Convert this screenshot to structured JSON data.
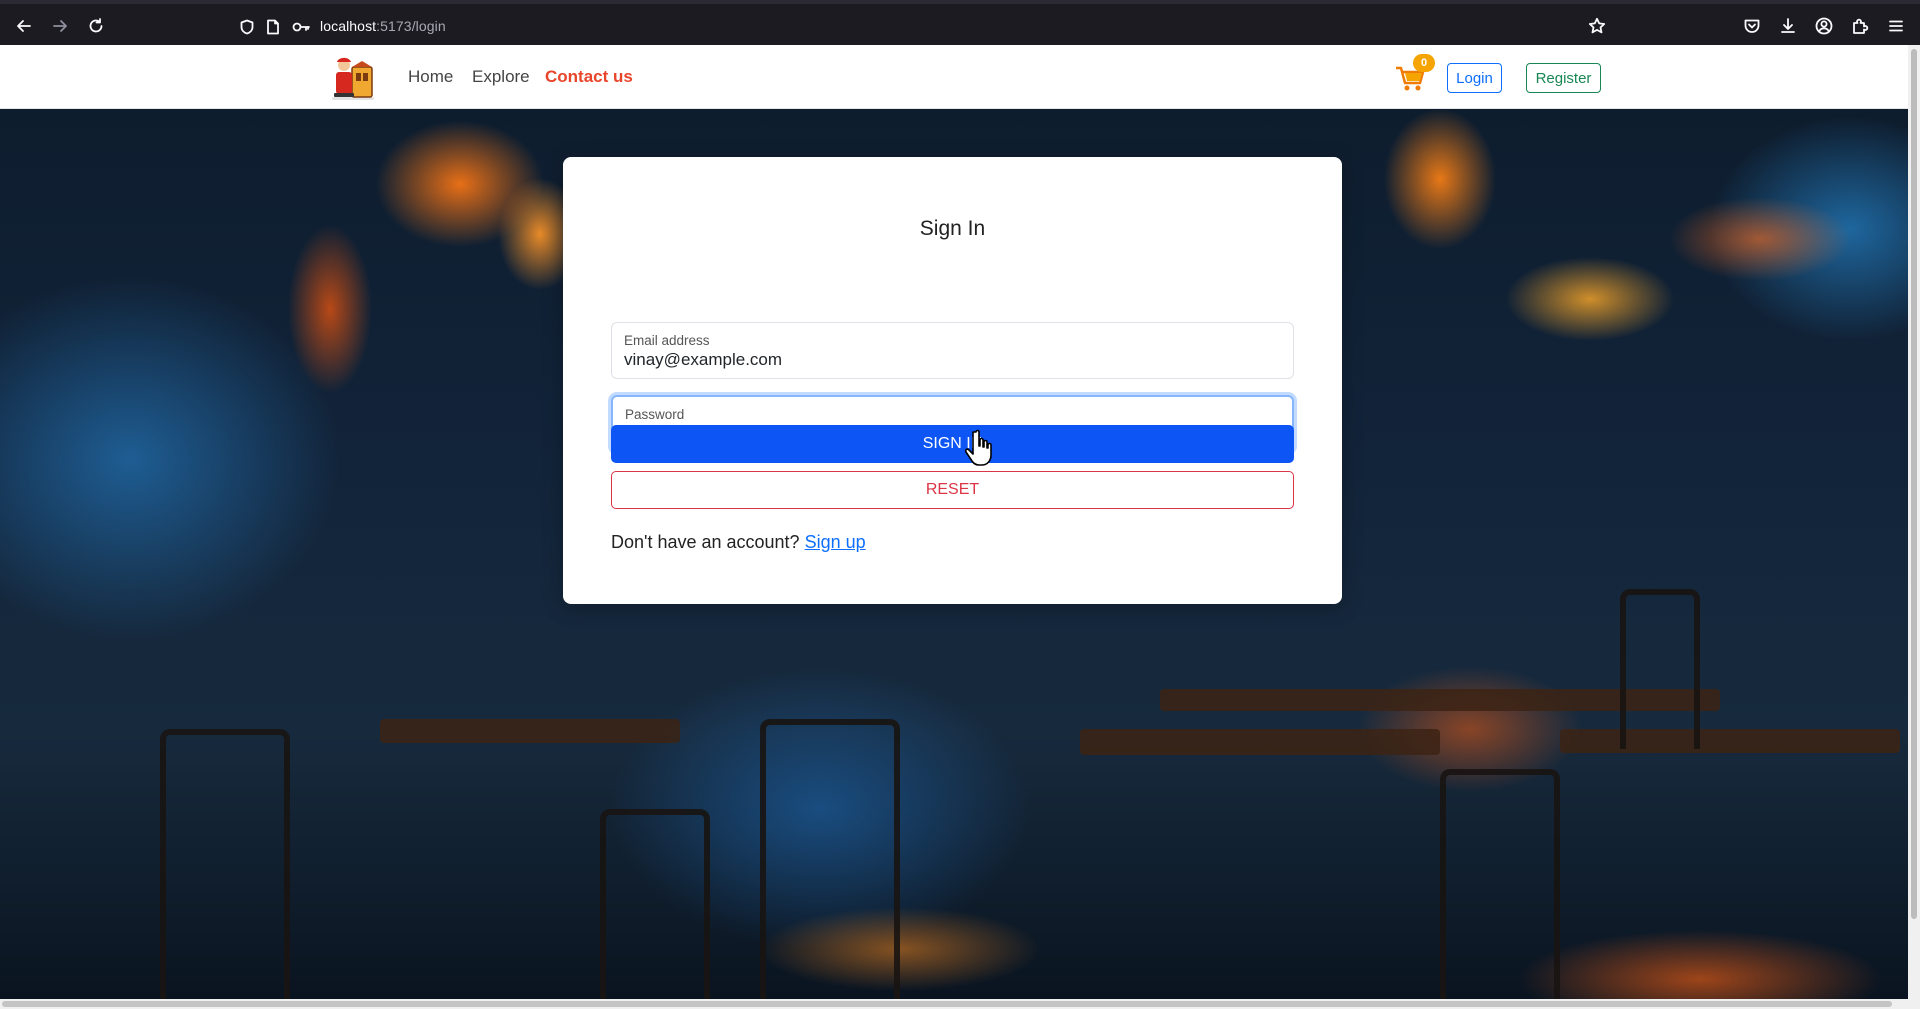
{
  "browser": {
    "url_host": "localhost",
    "url_path": ":5173/login",
    "icons": [
      "back-icon",
      "forward-icon",
      "reload-icon",
      "shield-icon",
      "page-icon",
      "key-icon",
      "bookmark-star-icon",
      "pocket-icon",
      "download-icon",
      "account-icon",
      "extensions-icon",
      "menu-icon"
    ]
  },
  "nav": {
    "links": [
      {
        "label": "Home",
        "active": false
      },
      {
        "label": "Explore",
        "active": false
      },
      {
        "label": "Contact us",
        "active": true
      }
    ],
    "cart_count": "0",
    "login_label": "Login",
    "register_label": "Register"
  },
  "login": {
    "title": "Sign In",
    "email_label": "Email address",
    "email_value": "vinay@example.com",
    "password_label": "Password",
    "password_value": "••••••",
    "sign_in_label": "SIGN IN",
    "reset_label": "RESET",
    "no_account_text": "Don't have an account?",
    "signup_link": "Sign up"
  },
  "colors": {
    "primary": "#0d56f5",
    "danger": "#dc3545",
    "success": "#198754",
    "accent": "#e8452b",
    "badge": "#f5a400"
  }
}
